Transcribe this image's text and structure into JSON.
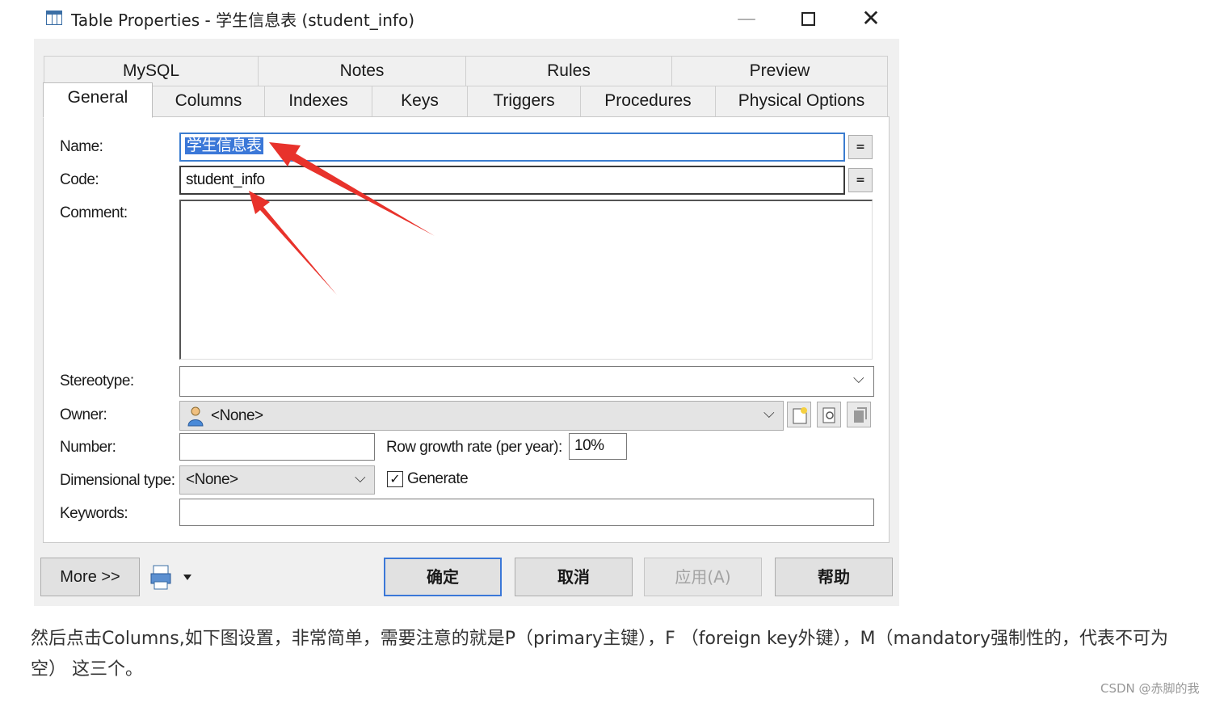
{
  "window": {
    "title": "Table Properties - 学生信息表 (student_info)",
    "controls": {
      "minimize": "—",
      "close": "✕"
    }
  },
  "tabs_row1": [
    "MySQL",
    "Notes",
    "Rules",
    "Preview"
  ],
  "tabs_row2": [
    "General",
    "Columns",
    "Indexes",
    "Keys",
    "Triggers",
    "Procedures",
    "Physical Options"
  ],
  "active_tab": "General",
  "form": {
    "name_label": "Name:",
    "name_value": "学生信息表",
    "code_label": "Code:",
    "code_value": "student_info",
    "comment_label": "Comment:",
    "comment_value": "",
    "stereotype_label": "Stereotype:",
    "stereotype_value": "",
    "owner_label": "Owner:",
    "owner_value": "<None>",
    "number_label": "Number:",
    "number_value": "",
    "growth_label": "Row growth rate (per year):",
    "growth_value": "10%",
    "dimensional_label": "Dimensional type:",
    "dimensional_value": "<None>",
    "generate_label": "Generate",
    "generate_checked": true,
    "keywords_label": "Keywords:",
    "keywords_value": "",
    "eq_label": "="
  },
  "buttons": {
    "more": "More >>",
    "ok": "确定",
    "cancel": "取消",
    "apply": "应用(A)",
    "help": "帮助"
  },
  "caption": "然后点击Columns,如下图设置，非常简单，需要注意的就是P（primary主键），F （foreign key外键），M（mandatory强制性的，代表不可为空） 这三个。",
  "watermark": "CSDN @赤脚的我",
  "colors": {
    "annotation_arrow": "#e8322b",
    "selection": "#3b78d8"
  }
}
